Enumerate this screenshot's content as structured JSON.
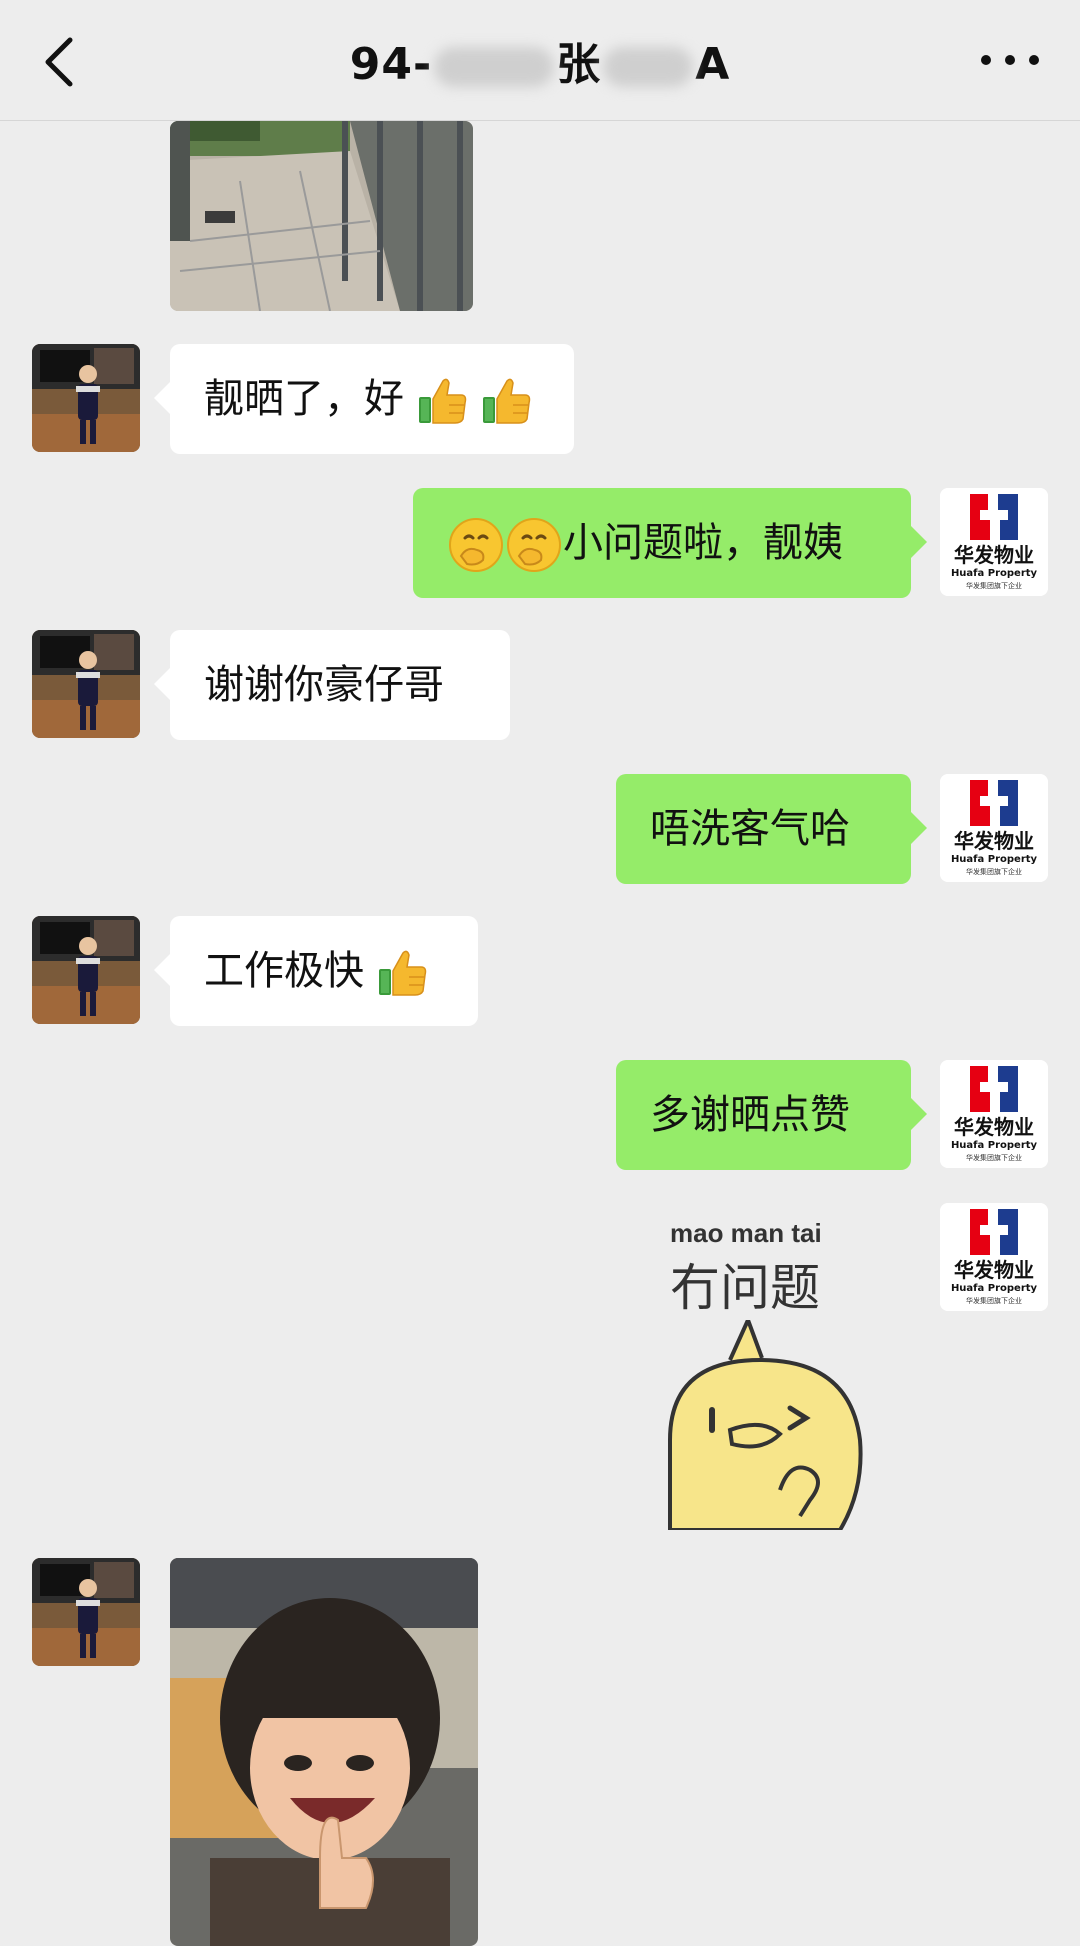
{
  "header": {
    "title_prefix": "94-",
    "title_mid": "张",
    "title_suffix": "A"
  },
  "messages": [
    {
      "side": "left",
      "type": "image",
      "desc": "photo-outdoor-path"
    },
    {
      "side": "left",
      "type": "text",
      "text": "靓晒了，好",
      "emoji": [
        "thumbs-up",
        "thumbs-up"
      ]
    },
    {
      "side": "right",
      "type": "text",
      "emoji_prefix": [
        "hand-over-mouth-face",
        "hand-over-mouth-face"
      ],
      "text": "小问题啦，靓姨"
    },
    {
      "side": "left",
      "type": "text",
      "text": "谢谢你豪仔哥"
    },
    {
      "side": "right",
      "type": "text",
      "text": "唔洗客气哈"
    },
    {
      "side": "left",
      "type": "text",
      "text": "工作极快",
      "emoji": [
        "thumbs-up"
      ]
    },
    {
      "side": "right",
      "type": "text",
      "text": "多谢晒点赞"
    },
    {
      "side": "right",
      "type": "sticker",
      "sticker_top": "mao man tai",
      "sticker_main": "冇问题"
    },
    {
      "side": "left",
      "type": "image",
      "desc": "photo-child-thumbs-up"
    }
  ],
  "avatars": {
    "right_logo_cn": "华发物业",
    "right_logo_en": "Huafa Property",
    "right_logo_sub": "华发集团旗下企业",
    "right_logo_colors": {
      "red": "#e60012",
      "blue": "#1d3c8f"
    }
  },
  "colors": {
    "background": "#ededed",
    "bubble_self": "#95ec69",
    "bubble_other": "#ffffff"
  }
}
